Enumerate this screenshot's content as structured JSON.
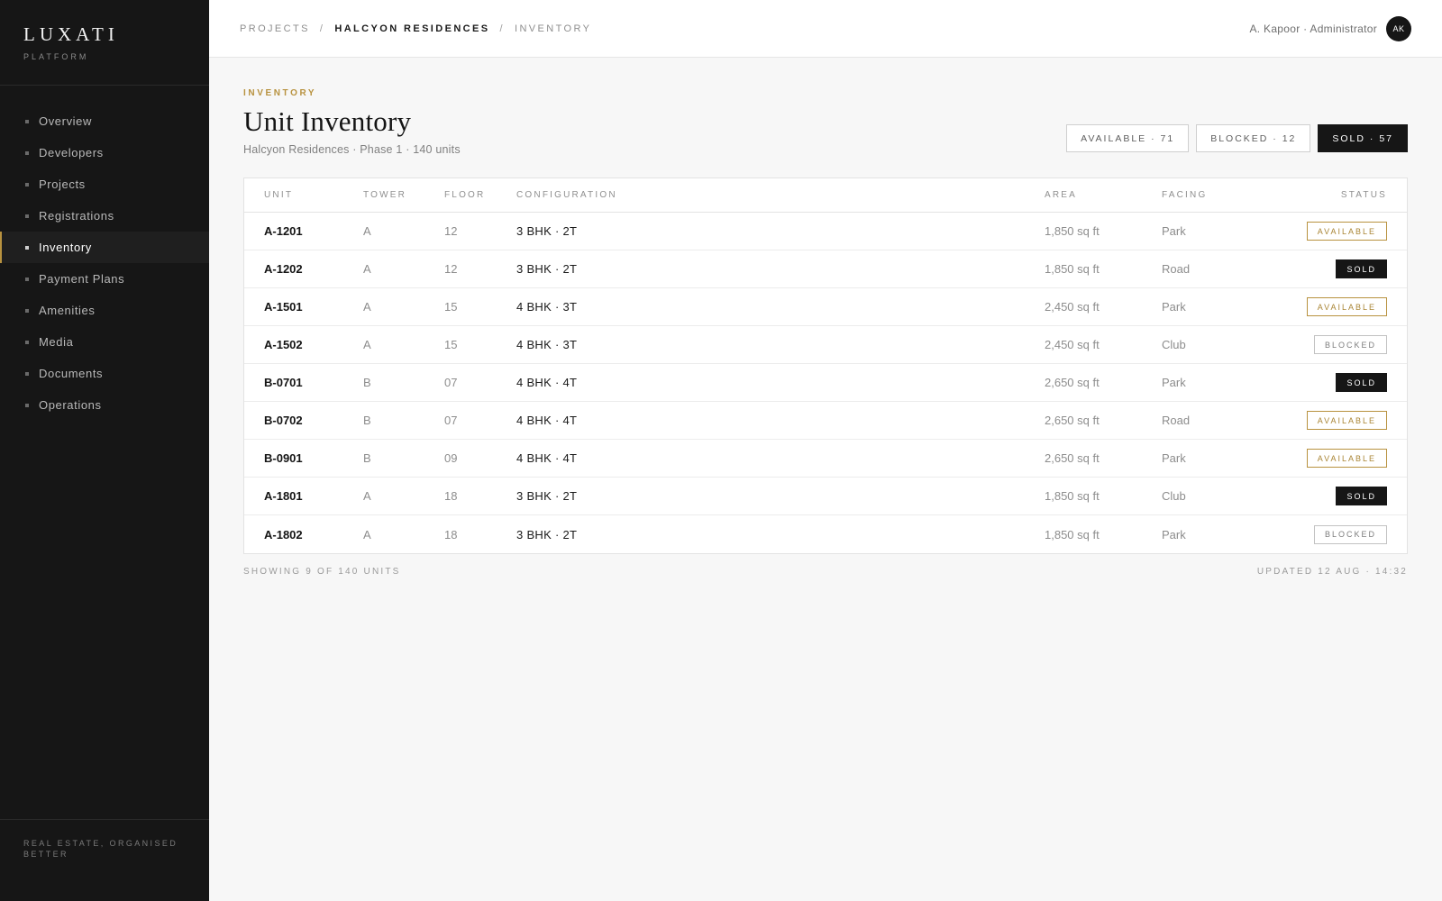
{
  "sidebar": {
    "brand": "LUXATI",
    "brand_sub": "PLATFORM",
    "items": [
      {
        "label": "Overview"
      },
      {
        "label": "Developers"
      },
      {
        "label": "Projects"
      },
      {
        "label": "Registrations"
      },
      {
        "label": "Inventory",
        "active": true
      },
      {
        "label": "Payment Plans"
      },
      {
        "label": "Amenities"
      },
      {
        "label": "Media"
      },
      {
        "label": "Documents"
      },
      {
        "label": "Operations"
      }
    ],
    "footer": "REAL ESTATE, ORGANISED BETTER"
  },
  "topbar": {
    "breadcrumb": [
      "PROJECTS",
      "HALCYON RESIDENCES",
      "INVENTORY"
    ],
    "separator": "/",
    "user": "A. Kapoor · Administrator",
    "avatar_initials": "AK"
  },
  "page": {
    "eyebrow": "INVENTORY",
    "title": "Unit Inventory",
    "subtitle": "Halcyon Residences · Phase 1 · 140 units"
  },
  "filters": [
    {
      "label": "AVAILABLE · 71",
      "selected": false
    },
    {
      "label": "BLOCKED · 12",
      "selected": false
    },
    {
      "label": "SOLD · 57",
      "selected": true
    }
  ],
  "table": {
    "headers": [
      "UNIT",
      "TOWER",
      "FLOOR",
      "CONFIGURATION",
      "AREA",
      "FACING",
      "STATUS"
    ],
    "rows": [
      {
        "unit": "A-1201",
        "tower": "A",
        "floor": "12",
        "config": "3 BHK · 2T",
        "area": "1,850 sq ft",
        "facing": "Park",
        "status": "AVAILABLE"
      },
      {
        "unit": "A-1202",
        "tower": "A",
        "floor": "12",
        "config": "3 BHK · 2T",
        "area": "1,850 sq ft",
        "facing": "Road",
        "status": "SOLD"
      },
      {
        "unit": "A-1501",
        "tower": "A",
        "floor": "15",
        "config": "4 BHK · 3T",
        "area": "2,450 sq ft",
        "facing": "Park",
        "status": "AVAILABLE"
      },
      {
        "unit": "A-1502",
        "tower": "A",
        "floor": "15",
        "config": "4 BHK · 3T",
        "area": "2,450 sq ft",
        "facing": "Club",
        "status": "BLOCKED"
      },
      {
        "unit": "B-0701",
        "tower": "B",
        "floor": "07",
        "config": "4 BHK · 4T",
        "area": "2,650 sq ft",
        "facing": "Park",
        "status": "SOLD"
      },
      {
        "unit": "B-0702",
        "tower": "B",
        "floor": "07",
        "config": "4 BHK · 4T",
        "area": "2,650 sq ft",
        "facing": "Road",
        "status": "AVAILABLE"
      },
      {
        "unit": "B-0901",
        "tower": "B",
        "floor": "09",
        "config": "4 BHK · 4T",
        "area": "2,650 sq ft",
        "facing": "Park",
        "status": "AVAILABLE"
      },
      {
        "unit": "A-1801",
        "tower": "A",
        "floor": "18",
        "config": "3 BHK · 2T",
        "area": "1,850 sq ft",
        "facing": "Club",
        "status": "SOLD"
      },
      {
        "unit": "A-1802",
        "tower": "A",
        "floor": "18",
        "config": "3 BHK · 2T",
        "area": "1,850 sq ft",
        "facing": "Park",
        "status": "BLOCKED"
      }
    ],
    "footer_left": "SHOWING 9 OF 140 UNITS",
    "footer_right": "UPDATED 12 AUG · 14:32"
  },
  "colors": {
    "accent_gold": "#b8923f",
    "sidebar_bg": "#161616",
    "sold_bg": "#161616"
  }
}
